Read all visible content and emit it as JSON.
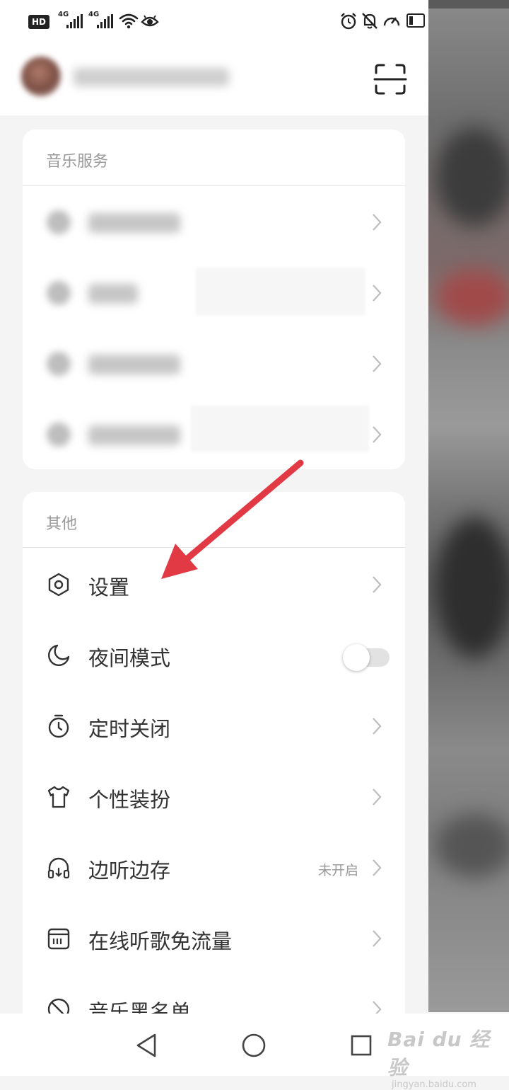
{
  "status_bar": {
    "hd_badge": "HD",
    "sim_slot": "1",
    "network_1": "4G",
    "network_2": "4G",
    "icons": [
      "wifi-icon",
      "eye-icon",
      "alarm-icon",
      "mute-icon",
      "speed-icon",
      "battery-icon"
    ]
  },
  "profile": {
    "avatar_icon": "avatar",
    "scan_icon": "scan-icon"
  },
  "music_services": {
    "title": "音乐服务",
    "items": [
      "blurred-item-1",
      "blurred-item-2",
      "blurred-item-3",
      "blurred-item-4"
    ]
  },
  "other": {
    "title": "其他",
    "items": [
      {
        "label": "设置",
        "icon": "settings-icon"
      },
      {
        "label": "夜间模式",
        "icon": "moon-icon",
        "toggle_on": false
      },
      {
        "label": "定时关闭",
        "icon": "timer-icon"
      },
      {
        "label": "个性装扮",
        "icon": "tshirt-icon"
      },
      {
        "label": "边听边存",
        "icon": "headphones-icon",
        "status": "未开启"
      },
      {
        "label": "在线听歌免流量",
        "icon": "sim-card-icon"
      },
      {
        "label": "音乐黑名单",
        "icon": "block-icon"
      }
    ]
  },
  "nav_bar": {
    "buttons": [
      "back-icon",
      "home-icon",
      "recents-icon"
    ]
  },
  "watermark": {
    "main": "Bai du 经验",
    "sub": "jingyan.baidu.com"
  },
  "colors": {
    "annotation_arrow": "#e23a45",
    "toggle_off": "#e2e2e2"
  }
}
